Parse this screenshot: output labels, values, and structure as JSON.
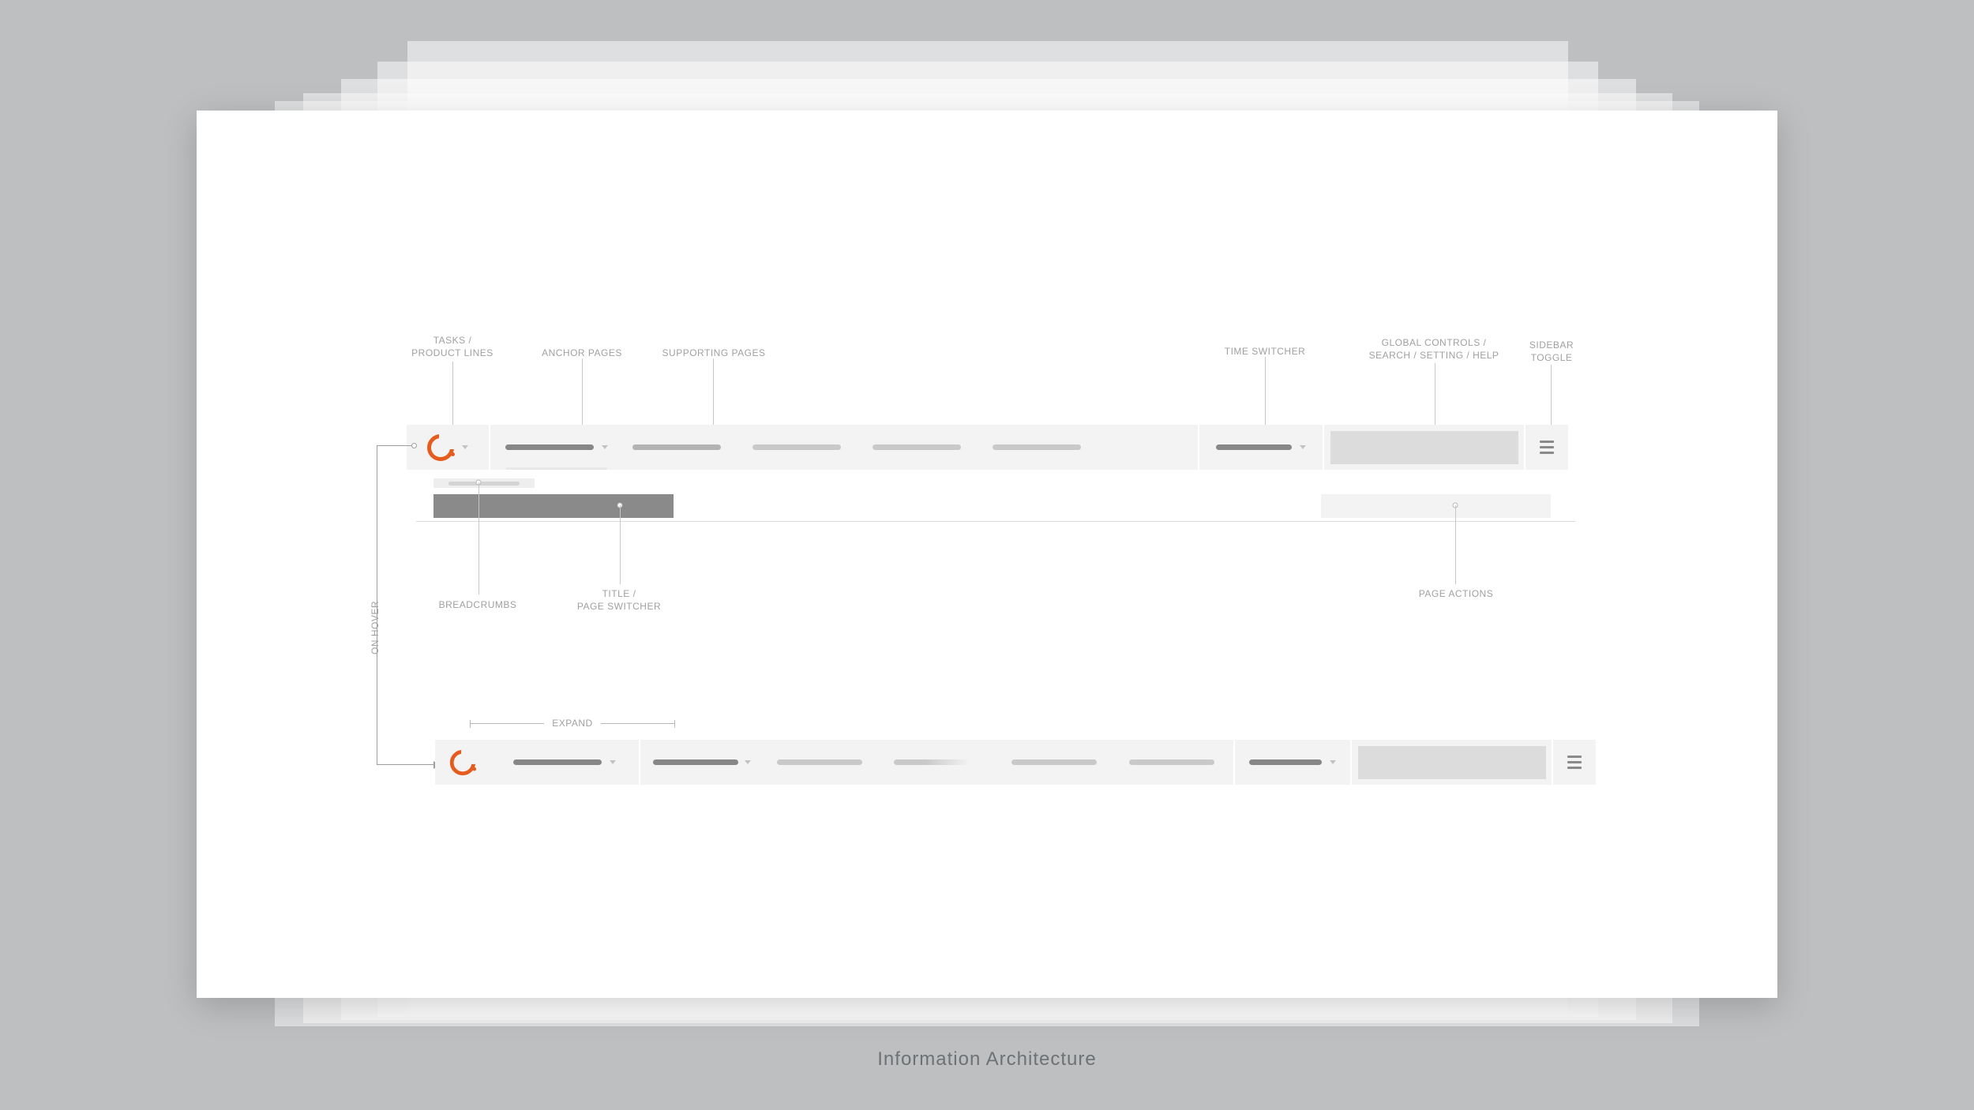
{
  "caption": "Information Architecture",
  "annotations": {
    "tasks": "TASKS /\nPRODUCT LINES",
    "anchor": "ANCHOR PAGES",
    "supporting": "SUPPORTING PAGES",
    "time": "TIME SWITCHER",
    "controls": "GLOBAL CONTROLS /\nSEARCH / SETTING / HELP",
    "sidebar": "SIDEBAR\nTOGGLE",
    "breadcrumbs": "BREADCRUMBS",
    "title": "TITLE /\nPAGE SWITCHER",
    "pageactions": "PAGE ACTIONS",
    "onhover": "ON HOVER",
    "expand": "EXPAND"
  },
  "colors": {
    "accent": "#e65c1e"
  }
}
